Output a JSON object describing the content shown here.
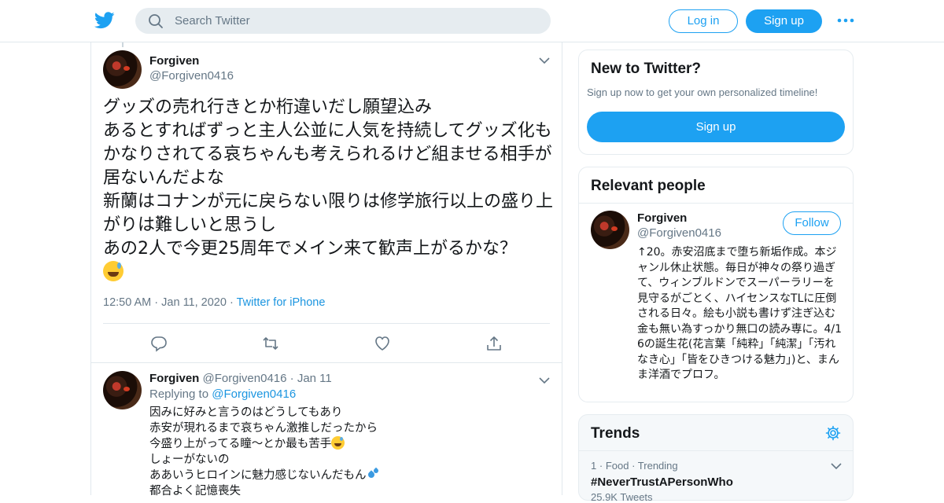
{
  "header": {
    "search_placeholder": "Search Twitter",
    "login_label": "Log in",
    "signup_label": "Sign up"
  },
  "main_tweet": {
    "name": "Forgiven",
    "handle": "@Forgiven0416",
    "lines": [
      "グッズの売れ行きとか桁違いだし願望込み",
      "あるとすればずっと主人公並に人気を持続してグッズ化もかなりされてる哀ちゃんも考えられるけど組ませる相手が居ないんだよな",
      "新蘭はコナンが元に戻らない限りは修学旅行以上の盛り上がりは難しいと思うし",
      "あの2人で今更25周年でメイン来て歓声上がるかな？"
    ],
    "time": "12:50 AM",
    "date": "Jan 11, 2020",
    "source": "Twitter for iPhone"
  },
  "reply": {
    "name": "Forgiven",
    "handle": "@Forgiven0416",
    "date": "Jan 11",
    "replying_to_label": "Replying to",
    "replying_to_handle": "@Forgiven0416",
    "lines": [
      "因みに好みと言うのはどうしてもあり",
      "赤安が現れるまで哀ちゃん激推しだったから",
      "今盛り上がってる瞳〜とか最も苦手",
      "しょーがないの",
      "ああいうヒロインに魅力感じないんだもん",
      "都合よく記憶喪失"
    ]
  },
  "sidebar": {
    "new_to_twitter": {
      "title": "New to Twitter?",
      "subtitle": "Sign up now to get your own personalized timeline!",
      "button_label": "Sign up"
    },
    "relevant_people": {
      "title": "Relevant people",
      "name": "Forgiven",
      "handle": "@Forgiven0416",
      "follow_label": "Follow",
      "bio": "↑20。赤安沼底まで堕ち新垢作成。本ジャンル休止状態。毎日が神々の祭り過ぎて、ウィンブルドンでスーパーラリーを見守るがごとく、ハイセンスなTLに圧倒される日々。絵も小説も書けず注ぎ込む金も無い為すっかり無口の読み専に。4/16の誕生花(花言葉「純粋」「純潔」「汚れなき心」「皆をひきつける魅力」)と、まんま洋酒でプロフ。"
    },
    "trends": {
      "title": "Trends",
      "item_rank": "1",
      "item_category": "Food",
      "item_status": "Trending",
      "item_name": "#NeverTrustAPersonWho",
      "item_count": "25.9K Tweets"
    }
  },
  "colors": {
    "brand": "#1da1f2",
    "link": "#1b95e0",
    "muted": "#657786",
    "border": "#e1e8ed"
  },
  "icons": [
    "twitter-bird-icon",
    "search-icon",
    "more-dots-icon",
    "chevron-down-icon",
    "reply-icon",
    "retweet-icon",
    "like-heart-icon",
    "share-icon",
    "gear-icon",
    "grinning-sweat-emoji",
    "sweat-droplets-emoji"
  ]
}
